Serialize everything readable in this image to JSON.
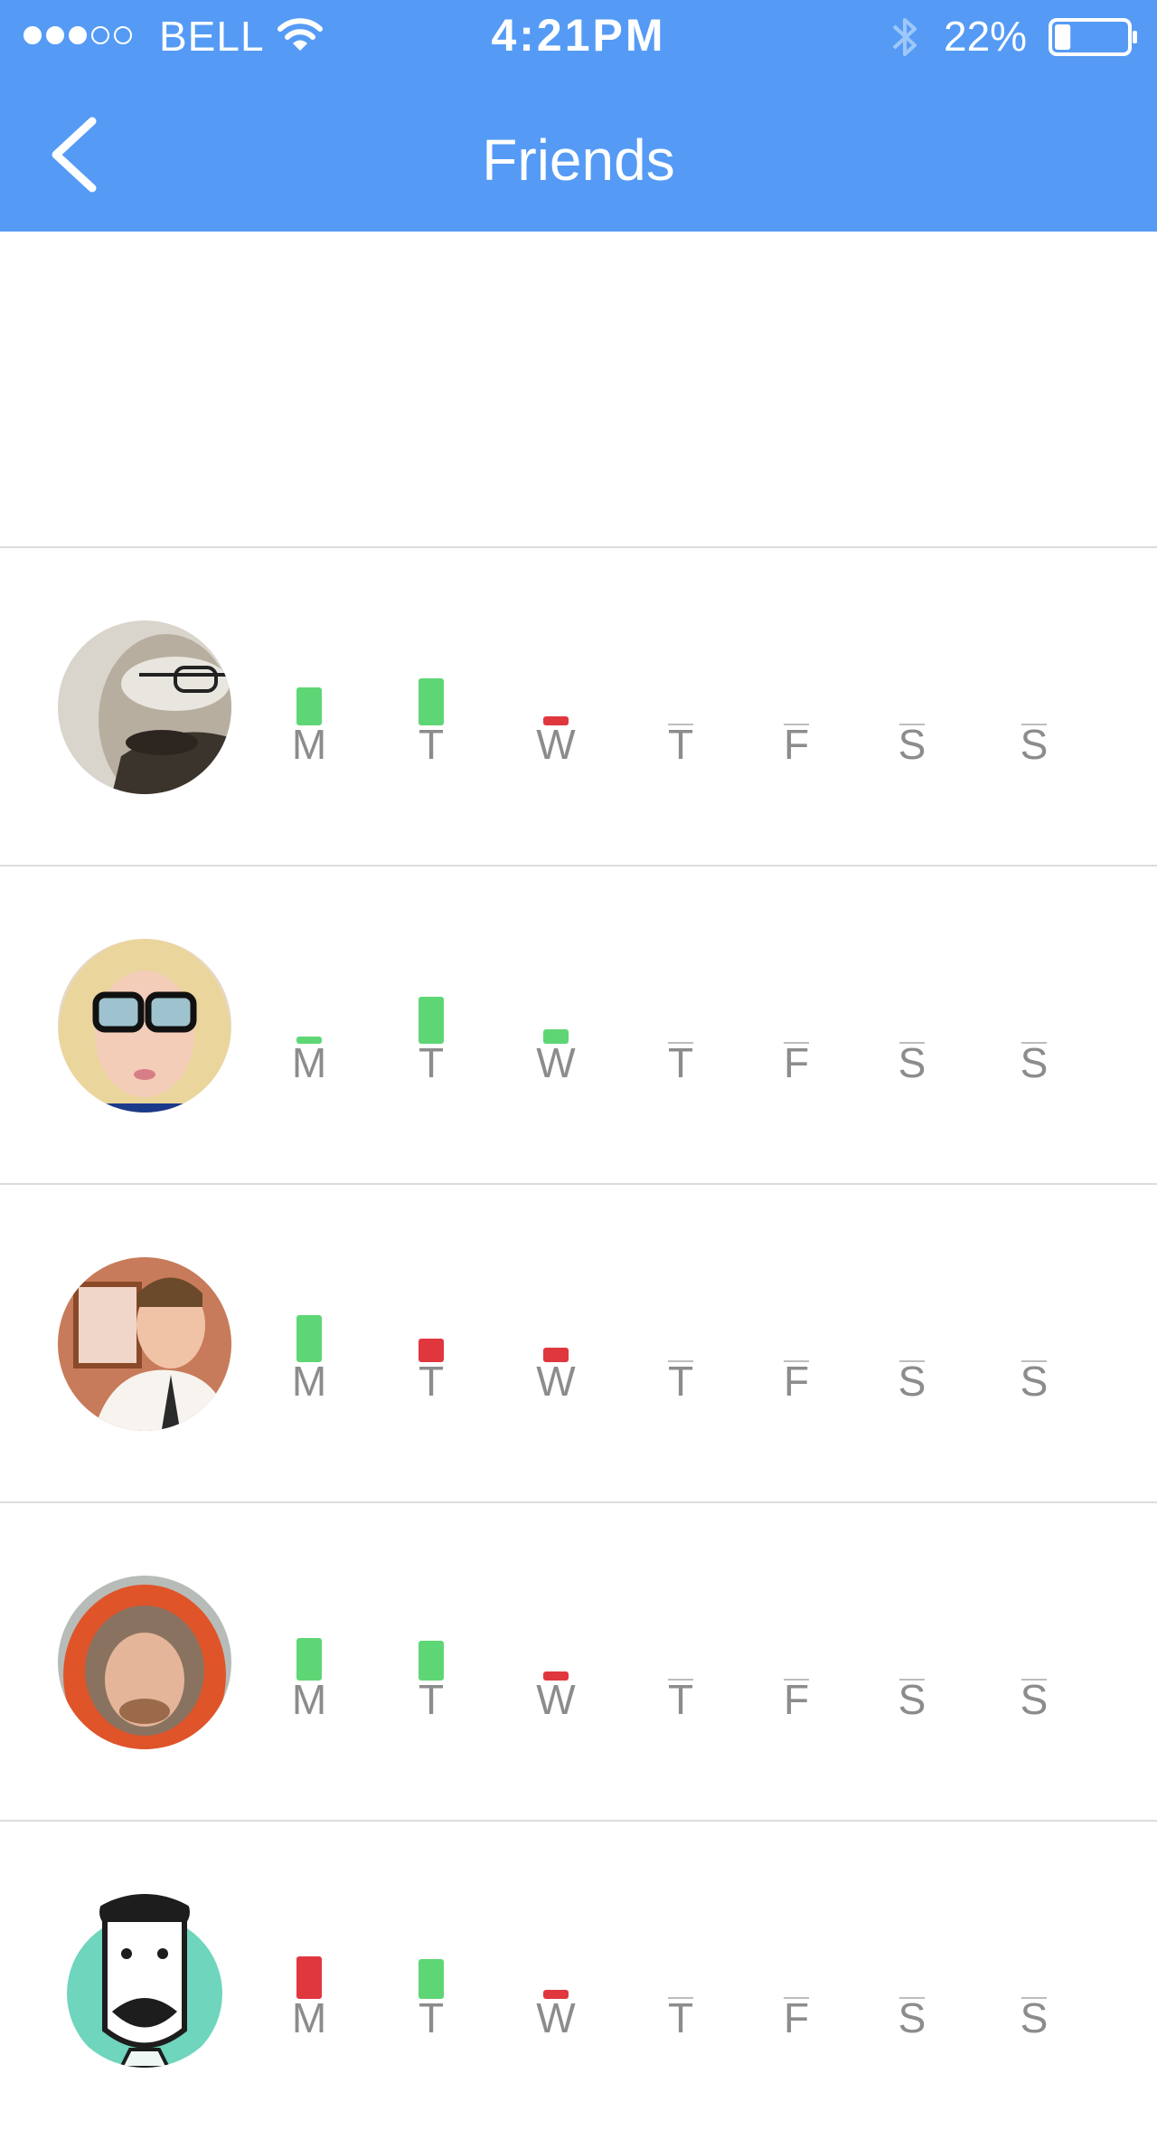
{
  "status_bar": {
    "carrier": "BELL",
    "time": "4:21PM",
    "battery_percent": "22%",
    "battery_level": 0.22,
    "signal_dots": [
      true,
      true,
      true,
      false,
      false
    ]
  },
  "nav": {
    "title": "Friends",
    "back_icon": "chevron-left-icon"
  },
  "colors": {
    "header": "#559bf5",
    "good": "#5fd675",
    "bad": "#e0373f",
    "empty": "#bdbdbd",
    "label": "#8c8c8c"
  },
  "days": [
    "M",
    "T",
    "W",
    "T",
    "F",
    "S",
    "S"
  ],
  "friends": [
    {
      "avatar_icon": "bearded-man-glasses-photo",
      "week": [
        {
          "status": "good",
          "level": 0.8
        },
        {
          "status": "good",
          "level": 1.0
        },
        {
          "status": "bad",
          "level": 0.2
        },
        {
          "status": "none",
          "level": 0
        },
        {
          "status": "none",
          "level": 0
        },
        {
          "status": "none",
          "level": 0
        },
        {
          "status": "none",
          "level": 0
        }
      ]
    },
    {
      "avatar_icon": "blonde-woman-glasses-photo",
      "week": [
        {
          "status": "good",
          "level": 0.1
        },
        {
          "status": "good",
          "level": 1.0
        },
        {
          "status": "good",
          "level": 0.3
        },
        {
          "status": "none",
          "level": 0
        },
        {
          "status": "none",
          "level": 0
        },
        {
          "status": "none",
          "level": 0
        },
        {
          "status": "none",
          "level": 0
        }
      ]
    },
    {
      "avatar_icon": "man-with-tie-photo",
      "week": [
        {
          "status": "good",
          "level": 1.0
        },
        {
          "status": "bad",
          "level": 0.5
        },
        {
          "status": "bad",
          "level": 0.3
        },
        {
          "status": "none",
          "level": 0
        },
        {
          "status": "none",
          "level": 0
        },
        {
          "status": "none",
          "level": 0
        },
        {
          "status": "none",
          "level": 0
        }
      ]
    },
    {
      "avatar_icon": "man-orange-hood-photo",
      "week": [
        {
          "status": "good",
          "level": 0.9
        },
        {
          "status": "good",
          "level": 0.85
        },
        {
          "status": "bad",
          "level": 0.2
        },
        {
          "status": "none",
          "level": 0
        },
        {
          "status": "none",
          "level": 0
        },
        {
          "status": "none",
          "level": 0
        },
        {
          "status": "none",
          "level": 0
        }
      ]
    },
    {
      "avatar_icon": "cartoon-mustache-man-avatar",
      "week": [
        {
          "status": "bad",
          "level": 0.9
        },
        {
          "status": "good",
          "level": 0.85
        },
        {
          "status": "bad",
          "level": 0.2
        },
        {
          "status": "none",
          "level": 0
        },
        {
          "status": "none",
          "level": 0
        },
        {
          "status": "none",
          "level": 0
        },
        {
          "status": "none",
          "level": 0
        }
      ]
    }
  ]
}
